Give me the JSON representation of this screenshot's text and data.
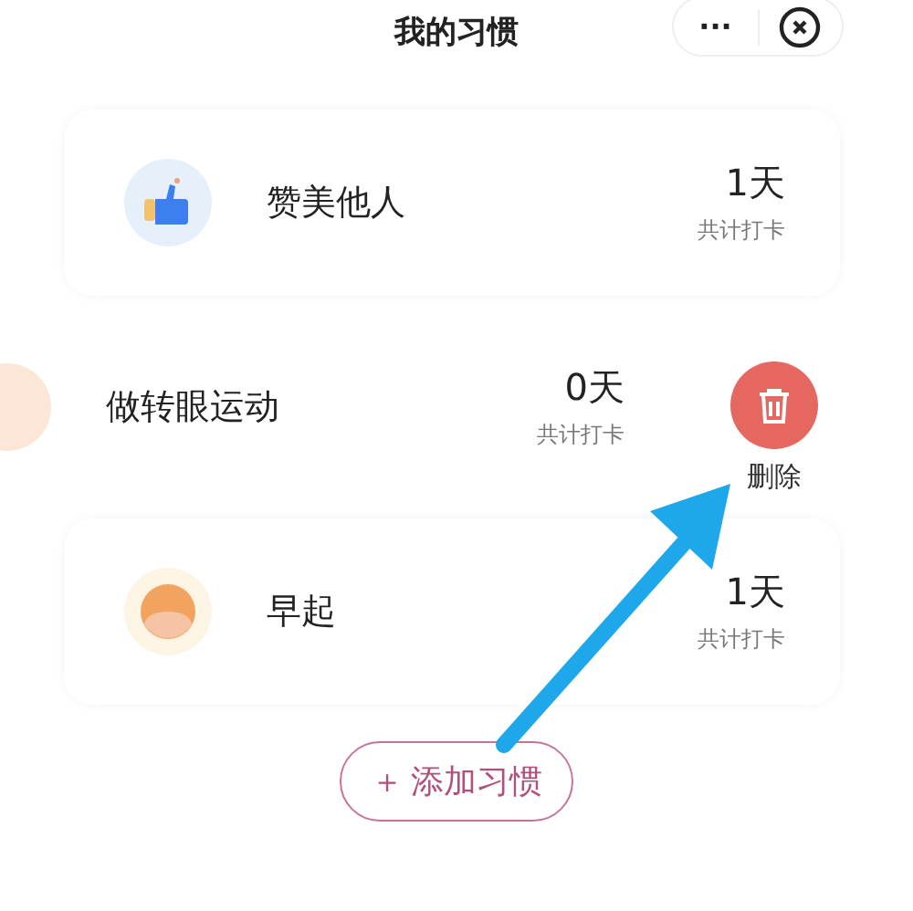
{
  "header": {
    "title": "我的习惯",
    "more": "···"
  },
  "habits": [
    {
      "name": "赞美他人",
      "kind": "thumb",
      "days": "1天",
      "caption": "共计打卡",
      "swiped": false
    },
    {
      "name": "做转眼运动",
      "kind": "face",
      "days": "0天",
      "caption": "共计打卡",
      "swiped": true,
      "delete_label": "删除"
    },
    {
      "name": "早起",
      "kind": "sun",
      "days": "1天",
      "caption": "共计打卡",
      "swiped": false
    }
  ],
  "add_button": {
    "plus": "＋",
    "label": "添加习惯"
  }
}
